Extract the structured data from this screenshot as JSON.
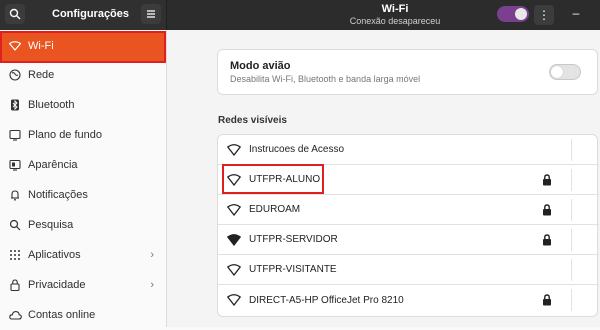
{
  "titlebar": {
    "app_title": "Configurações",
    "window_title": "Wi-Fi",
    "window_subtitle": "Conexão desapareceu",
    "menu_label": "⋮",
    "minimize_label": "–",
    "wifi_enabled": true
  },
  "sidebar": {
    "items": [
      {
        "label": "Wi-Fi",
        "icon": "wifi-icon"
      },
      {
        "label": "Rede",
        "icon": "network-icon"
      },
      {
        "label": "Bluetooth",
        "icon": "bluetooth-icon"
      },
      {
        "label": "Plano de fundo",
        "icon": "background-icon"
      },
      {
        "label": "Aparência",
        "icon": "appearance-icon"
      },
      {
        "label": "Notificações",
        "icon": "bell-icon"
      },
      {
        "label": "Pesquisa",
        "icon": "search-icon"
      },
      {
        "label": "Aplicativos",
        "icon": "apps-icon"
      },
      {
        "label": "Privacidade",
        "icon": "lock-icon"
      },
      {
        "label": "Contas online",
        "icon": "cloud-icon"
      }
    ],
    "active_index": 0
  },
  "airplane": {
    "title": "Modo avião",
    "subtitle": "Desabilita Wi-Fi, Bluetooth e banda larga móvel",
    "enabled": false
  },
  "networks": {
    "section_title": "Redes visíveis",
    "items": [
      {
        "name": "Instrucoes de Acesso",
        "locked": false,
        "signal": "medium"
      },
      {
        "name": "UTFPR-ALUNO",
        "locked": true,
        "signal": "medium"
      },
      {
        "name": "EDUROAM",
        "locked": true,
        "signal": "medium"
      },
      {
        "name": "UTFPR-SERVIDOR",
        "locked": true,
        "signal": "full"
      },
      {
        "name": "UTFPR-VISITANTE",
        "locked": false,
        "signal": "medium"
      },
      {
        "name": "DIRECT-A5-HP OfficeJet Pro 8210",
        "locked": true,
        "signal": "medium"
      }
    ]
  },
  "colors": {
    "accent": "#e95420",
    "highlight_border": "#e02020",
    "toggle_on": "#7b3f8f"
  }
}
